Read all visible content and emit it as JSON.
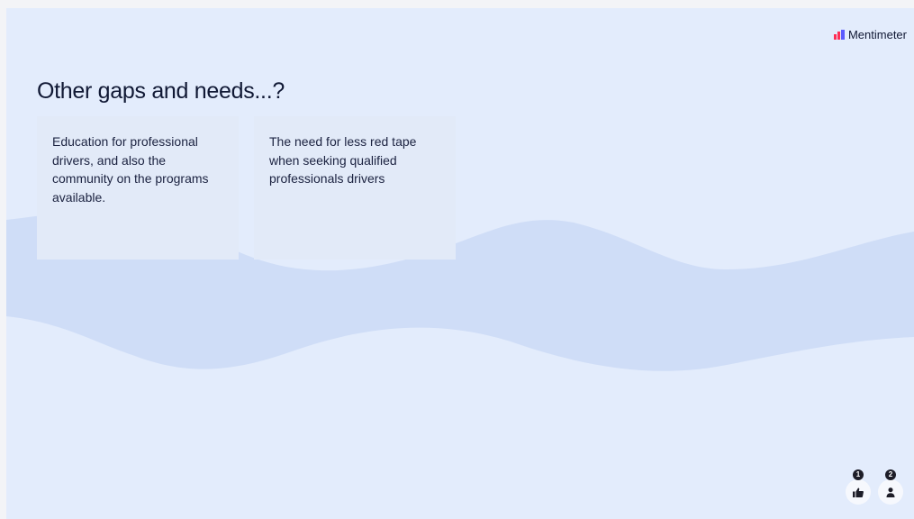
{
  "brand": {
    "name": "Mentimeter",
    "logo_colors": [
      "#ff2e55",
      "#5b5bff"
    ]
  },
  "title": "Other gaps and needs...?",
  "responses": [
    "Education for professional drivers, and also the community on the programs available.",
    "The need for less red tape when seeking qualified professionals drivers"
  ],
  "reactions": [
    {
      "icon": "thumbs-up-icon",
      "count": "1"
    },
    {
      "icon": "person-icon",
      "count": "2"
    }
  ],
  "colors": {
    "background": "#e3ecfc",
    "wave": "#cfddf7",
    "card": "#e2eaf8",
    "text": "#101834"
  }
}
